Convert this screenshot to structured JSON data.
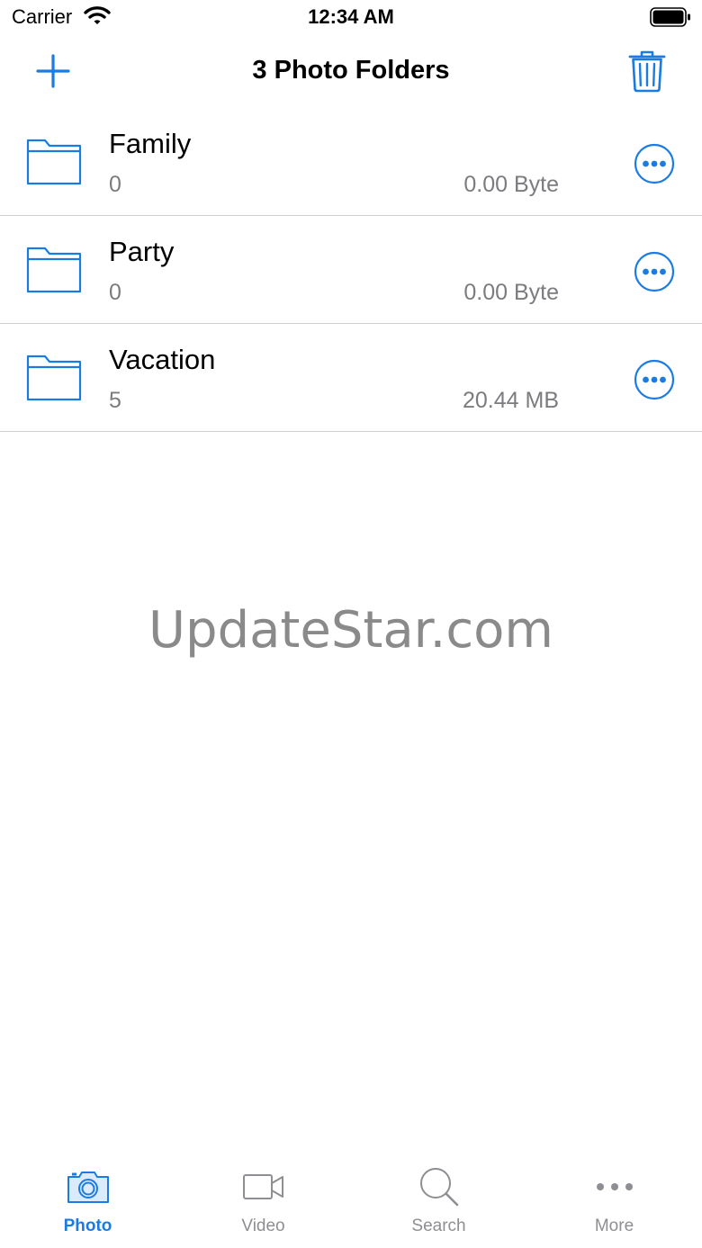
{
  "status_bar": {
    "carrier": "Carrier",
    "time": "12:34 AM"
  },
  "nav": {
    "title": "3 Photo Folders",
    "add_icon": "plus-icon",
    "delete_icon": "trash-icon"
  },
  "folders": [
    {
      "name": "Family",
      "count": "0",
      "size": "0.00 Byte"
    },
    {
      "name": "Party",
      "count": "0",
      "size": "0.00 Byte"
    },
    {
      "name": "Vacation",
      "count": "5",
      "size": "20.44 MB"
    }
  ],
  "watermark": "UpdateStar.com",
  "tabs": [
    {
      "label": "Photo",
      "icon": "camera-icon",
      "active": true
    },
    {
      "label": "Video",
      "icon": "video-camera-icon",
      "active": false
    },
    {
      "label": "Search",
      "icon": "magnifier-icon",
      "active": false
    },
    {
      "label": "More",
      "icon": "ellipsis-icon",
      "active": false
    }
  ],
  "colors": {
    "accent": "#1a7ce0",
    "secondary_text": "#7c7c80",
    "inactive_tab": "#8e8e93",
    "separator": "#cfcfd3"
  }
}
